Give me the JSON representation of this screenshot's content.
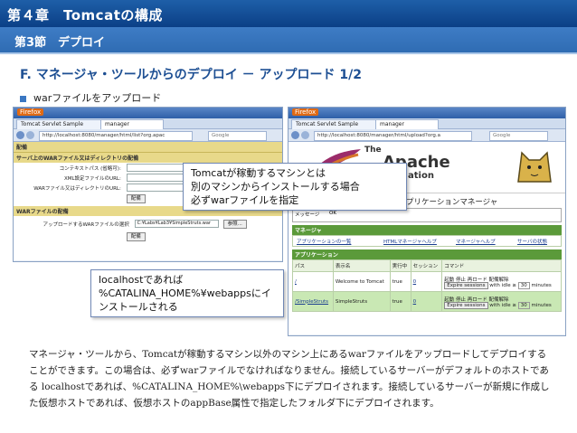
{
  "slide": {
    "chapter_title": "第４章　Tomcatの構成",
    "section": "第3節　デプロイ",
    "heading": "F. マネージャ・ツールからのデプロイ － アップロード 1/2",
    "bullet": "warファイルをアップロード"
  },
  "left_browser": {
    "app_name": "Firefox",
    "tab1": "Tomcat Servlet Sample",
    "tab2": "manager",
    "url": "http://localhost:8080/manager/html/list?org.apac",
    "search": "Google",
    "deploy_header": "配備",
    "deploy_sub": "サーバ上のWARファイル又はディレクトリの配備",
    "fields": [
      {
        "label": "コンテキストパス (省略可):",
        "value": ""
      },
      {
        "label": "XML設定ファイルのURL:",
        "value": ""
      },
      {
        "label": "WARファイル又はディレクトリのURL:",
        "value": ""
      }
    ],
    "deploy_button": "配備",
    "war_header": "WARファイルの配備",
    "war_label": "アップロードするWARファイルの選択",
    "war_value": "C:¥Labs¥Lab3¥SimpleStruts.war",
    "browse_button": "参照...",
    "war_deploy_button": "配備"
  },
  "right_browser": {
    "app_name": "Firefox",
    "tab1": "Tomcat Servlet Sample",
    "tab2": "manager",
    "url": "http://localhost:8080/manager/html/upload?org.a",
    "search": "Google",
    "logo_text1": "The",
    "logo_text2": "Apache",
    "logo_text3": "ation",
    "title_suffix": "プリケーションマネージャ",
    "message_label": "メッセージ",
    "message_value": "OK",
    "manager_header": "マネージャ",
    "manager_links": [
      "アプリケーションの一覧",
      "HTMLマネージャヘルプ",
      "マネージャヘルプ",
      "サーバの状態"
    ],
    "apps_header": "アプリケーション",
    "columns": [
      "パス",
      "表示名",
      "実行中",
      "セッション",
      "コマンド"
    ],
    "rows": [
      {
        "path": "/",
        "name": "Welcome to Tomcat",
        "running": "true",
        "sessions": "0"
      },
      {
        "path": "/SimpleStruts",
        "name": "SimpleStruts",
        "running": "true",
        "sessions": "0"
      }
    ],
    "commands": [
      "起動",
      "停止",
      "再ロード",
      "配備解除"
    ],
    "expire_button": "Expire sessions",
    "idle_label1": "with idle ≥",
    "idle_value": "30",
    "idle_label2": "minutes"
  },
  "callouts": {
    "center": [
      "Tomcatが稼動するマシンとは",
      "別のマシンからインストールする場合",
      "必ずwarファイルを指定"
    ],
    "lower": [
      "localhostであれば",
      "%CATALINA_HOME%¥webappsにイ",
      "ンストールされる"
    ]
  },
  "body_text": "マネージャ・ツールから、Tomcatが稼動するマシン以外のマシン上にあるwarファイルをアップロードしてデプロイすることができます。この場合は、必ずwarファイルでなければなりません。接続しているサーバーがデフォルトのホストである localhostであれば、%CATALINA_HOME%\\webapps下にデプロイされます。接続しているサーバーが新規に作成した仮想ホストであれば、仮想ホストのappBase属性で指定したフォルダ下にデプロイされます。"
}
